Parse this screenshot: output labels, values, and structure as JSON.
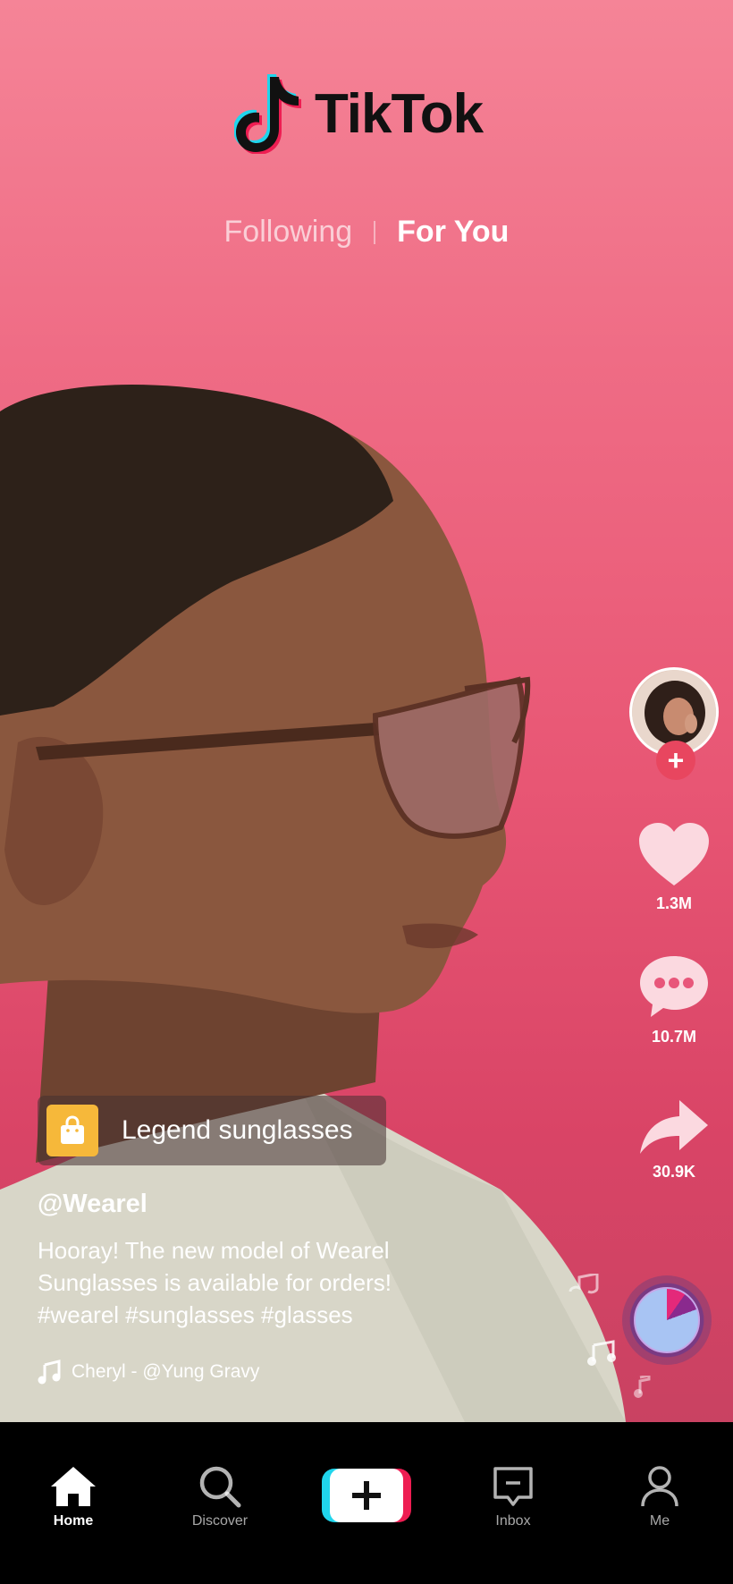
{
  "app": {
    "name": "TikTok"
  },
  "colors": {
    "brand_red": "#EE1D52",
    "brand_cyan": "#20D5EC",
    "background": "#E85674",
    "product_tag_accent": "#F6B83A"
  },
  "feed_tabs": {
    "following": "Following",
    "for_you": "For You",
    "active": "For You"
  },
  "actions": {
    "likes": "1.3M",
    "comments": "10.7M",
    "shares": "30.9K"
  },
  "post": {
    "product_tag": "Legend sunglasses",
    "username": "@Wearel",
    "caption_lines": [
      "Hooray! The new model of Wearel",
      "Sunglasses is available for orders!",
      "#wearel #sunglasses #glasses"
    ],
    "sound": "Cheryl - @Yung Gravy"
  },
  "nav": {
    "home": "Home",
    "discover": "Discover",
    "inbox": "Inbox",
    "me": "Me",
    "active": "Home"
  },
  "icons": [
    "tiktok-logo-icon",
    "plus-icon",
    "heart-icon",
    "comment-icon",
    "share-icon",
    "music-disc-icon",
    "music-note-icon",
    "shopping-bag-icon",
    "home-icon",
    "search-icon",
    "create-icon",
    "inbox-icon",
    "profile-icon"
  ]
}
